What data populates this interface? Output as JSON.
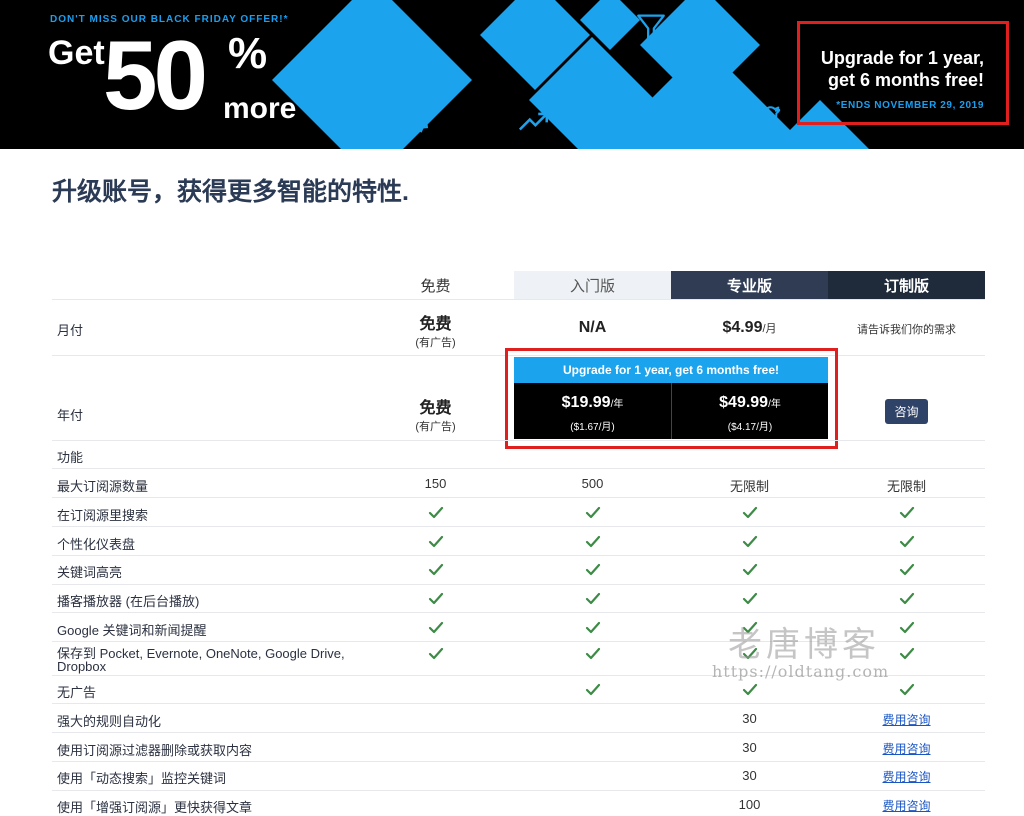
{
  "banner": {
    "promo_top": "DON'T MISS OUR BLACK FRIDAY OFFER!*",
    "get": "Get",
    "fifty": "50",
    "percent": "%",
    "more": "more",
    "offer_line1": "Upgrade for 1 year,",
    "offer_line2": "get 6 months free!",
    "offer_ends": "*ENDS NOVEMBER 29, 2019",
    "accent_color": "#1a9ff0",
    "icons": [
      "bell-icon",
      "filter-icon",
      "gear-icon",
      "trending-icon",
      "facebook-icon",
      "twitter-icon"
    ]
  },
  "page_title": "升级账号，获得更多智能的特性.",
  "plans": {
    "free": "免费",
    "starter": "入门版",
    "pro": "专业版",
    "custom": "订制版"
  },
  "monthly": {
    "label": "月付",
    "free_price": "免费",
    "free_note": "(有广告)",
    "starter_price": "N/A",
    "pro_price": "$4.99",
    "pro_unit": "/月",
    "custom_text": "请告诉我们你的需求"
  },
  "annual": {
    "label": "年付",
    "free_price": "免费",
    "free_note": "(有广告)",
    "upgrade_banner": "Upgrade for 1 year, get 6 months free!",
    "starter_price": "$19.99",
    "starter_unit": "/年",
    "starter_monthly": "($1.67/月)",
    "pro_price": "$49.99",
    "pro_unit": "/年",
    "pro_monthly": "($4.17/月)",
    "custom_button": "咨询"
  },
  "features_label": "功能",
  "feature_rows": [
    {
      "label": "最大订阅源数量",
      "cells": [
        "150",
        "500",
        "无限制",
        "无限制"
      ]
    },
    {
      "label": "在订阅源里搜索",
      "cells": [
        "✓",
        "✓",
        "✓",
        "✓"
      ]
    },
    {
      "label": "个性化仪表盘",
      "cells": [
        "✓",
        "✓",
        "✓",
        "✓"
      ]
    },
    {
      "label": "关键词高亮",
      "cells": [
        "✓",
        "✓",
        "✓",
        "✓"
      ]
    },
    {
      "label": "播客播放器 (在后台播放)",
      "cells": [
        "✓",
        "✓",
        "✓",
        "✓"
      ]
    },
    {
      "label": "Google 关键词和新闻提醒",
      "cells": [
        "✓",
        "✓",
        "✓",
        "✓"
      ]
    },
    {
      "label_line1": "保存到 Pocket, Evernote, OneNote, Google Drive,",
      "label_line2": "Dropbox",
      "cells": [
        "✓",
        "✓",
        "✓",
        "✓"
      ]
    },
    {
      "label": "无广告",
      "cells": [
        "",
        "✓",
        "✓",
        "✓"
      ]
    },
    {
      "label": "强大的规则自动化",
      "cells": [
        "",
        "",
        "30",
        "费用咨询"
      ]
    },
    {
      "label": "使用订阅源过滤器删除或获取内容",
      "cells": [
        "",
        "",
        "30",
        "费用咨询"
      ]
    },
    {
      "label": "使用「动态搜索」监控关键词",
      "cells": [
        "",
        "",
        "30",
        "费用咨询"
      ]
    },
    {
      "label": "使用「增强订阅源」更快获得文章",
      "cells": [
        "",
        "",
        "100",
        "费用咨询"
      ]
    }
  ],
  "watermark": {
    "cn": "老唐博客",
    "url": "https://oldtang.com"
  }
}
